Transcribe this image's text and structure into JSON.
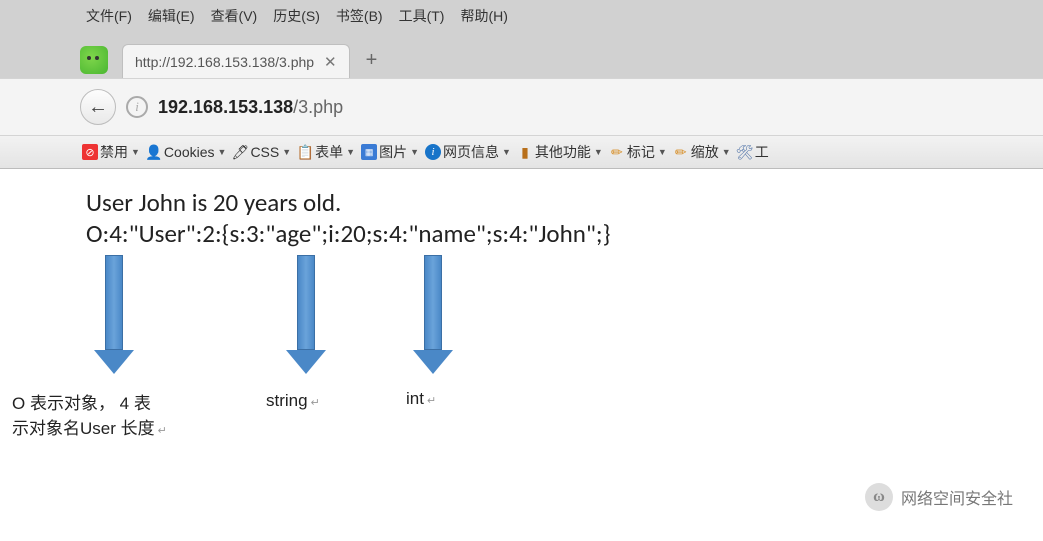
{
  "menu": {
    "file": "文件(F)",
    "edit": "编辑(E)",
    "view": "查看(V)",
    "history": "历史(S)",
    "bookmarks": "书签(B)",
    "tools": "工具(T)",
    "help": "帮助(H)"
  },
  "tab": {
    "title": "http://192.168.153.138/3.php"
  },
  "url": {
    "host": "192.168.153.138",
    "path": "/3.php"
  },
  "toolbar": {
    "disable": "禁用",
    "cookies": "Cookies",
    "css": "CSS",
    "forms": "表单",
    "images": "图片",
    "pageinfo": "网页信息",
    "other": "其他功能",
    "mark": "标记",
    "zoom": "缩放",
    "tool": "工"
  },
  "page": {
    "line1": "User John is 20 years old.",
    "line2": "O:4:\"User\":2:{s:3:\"age\";i:20;s:4:\"name\";s:4:\"John\";}"
  },
  "annotations": {
    "a1_l1": "O 表示对象， 4 表",
    "a1_l2": "示对象名User 长度",
    "a2": "string",
    "a3": "int"
  },
  "watermark": "网络空间安全社"
}
